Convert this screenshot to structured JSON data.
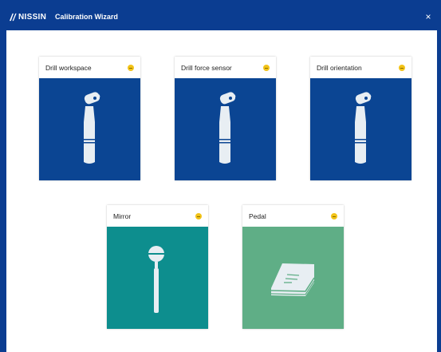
{
  "window": {
    "brand": "NISSIN",
    "title": "Calibration Wizard",
    "close_glyph": "×"
  },
  "cards": [
    {
      "label": "Drill workspace",
      "icon": "drill-handpiece-icon",
      "color": "#0b4593",
      "status": "pending"
    },
    {
      "label": "Drill force sensor",
      "icon": "drill-handpiece-icon",
      "color": "#0b4593",
      "status": "pending"
    },
    {
      "label": "Drill orientation",
      "icon": "drill-handpiece-icon",
      "color": "#0b4593",
      "status": "pending"
    },
    {
      "label": "Mirror",
      "icon": "dental-mirror-icon",
      "color": "#0d8e8e",
      "status": "pending"
    },
    {
      "label": "Pedal",
      "icon": "foot-pedal-icon",
      "color": "#5fae86",
      "status": "pending"
    }
  ],
  "status_color": "#f2c318"
}
